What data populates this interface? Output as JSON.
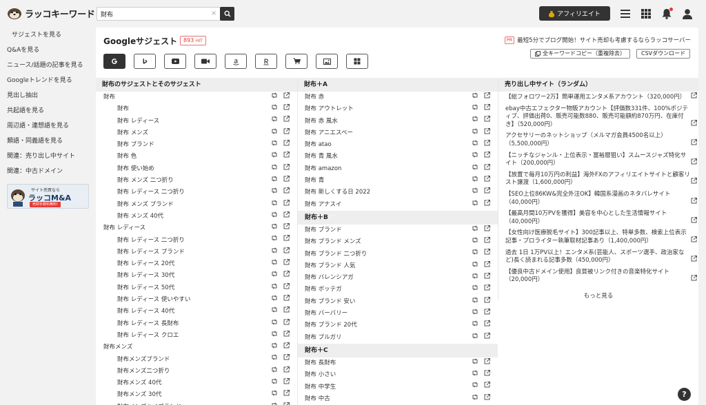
{
  "header": {
    "logo_text": "ラッコキーワード",
    "search": {
      "value": "財布",
      "clear_icon": "×"
    },
    "affiliate_label": "アフィリエイト"
  },
  "sidebar": {
    "items": [
      "サジェストを見る",
      "Q&Aを見る",
      "ニュース/話題の記事を見る",
      "Googleトレンドを見る",
      "見出し抽出",
      "共起語を見る",
      "周辺語・連想語を見る",
      "類語・同義語を見る",
      "関連：売り出し中サイト",
      "関連：中古ドメイン"
    ],
    "banner": {
      "small": "サイト売買なら",
      "big": "ラッコM&A",
      "red": "売却手数料無料!"
    }
  },
  "main": {
    "title": "Googleサジェスト",
    "hit_count": "893",
    "hit_unit": "HIT",
    "pr_tag": "PR",
    "pr_text": "最短5分でブログ開始！サイト売却も考慮するならラッコサーバー",
    "copy_all_label": "全キーワードコピー（重複除去）",
    "csv_label": "CSVダウンロード"
  },
  "col1": {
    "header": "財布のサジェストとそのサジェスト",
    "rows": [
      {
        "text": "財布",
        "level": 1
      },
      {
        "text": "財布",
        "level": 2
      },
      {
        "text": "財布 レディース",
        "level": 2
      },
      {
        "text": "財布 メンズ",
        "level": 2
      },
      {
        "text": "財布 ブランド",
        "level": 2
      },
      {
        "text": "財布 色",
        "level": 2
      },
      {
        "text": "財布 使い始め",
        "level": 2
      },
      {
        "text": "財布 メンズ 二つ折り",
        "level": 2
      },
      {
        "text": "財布 レディース 二つ折り",
        "level": 2
      },
      {
        "text": "財布 メンズ ブランド",
        "level": 2
      },
      {
        "text": "財布 メンズ 40代",
        "level": 2
      },
      {
        "text": "財布 レディース",
        "level": 1
      },
      {
        "text": "財布 レディース 二つ折り",
        "level": 2
      },
      {
        "text": "財布 レディース ブランド",
        "level": 2
      },
      {
        "text": "財布 レディース 20代",
        "level": 2
      },
      {
        "text": "財布 レディース 30代",
        "level": 2
      },
      {
        "text": "財布 レディース 50代",
        "level": 2
      },
      {
        "text": "財布 レディース 使いやすい",
        "level": 2
      },
      {
        "text": "財布 レディース 40代",
        "level": 2
      },
      {
        "text": "財布 レディース 長財布",
        "level": 2
      },
      {
        "text": "財布 レディース クロエ",
        "level": 2
      },
      {
        "text": "財布メンズ",
        "level": 1
      },
      {
        "text": "財布メンズブランド",
        "level": 2
      },
      {
        "text": "財布メンズ二つ折り",
        "level": 2
      },
      {
        "text": "財布メンズ 40代",
        "level": 2
      },
      {
        "text": "財布メンズ 30代",
        "level": 2
      },
      {
        "text": "財布メンズハイブランド",
        "level": 2
      }
    ]
  },
  "col2": {
    "groups": [
      {
        "header": "財布＋A",
        "rows": [
          "財布 赤",
          "財布 アウトレット",
          "財布 赤 風水",
          "財布 アニエスベー",
          "財布 atao",
          "財布 青 風水",
          "財布 amazon",
          "財布 青",
          "財布 新しくする日 2022",
          "財布 アナスイ"
        ]
      },
      {
        "header": "財布＋B",
        "rows": [
          "財布 ブランド",
          "財布 ブランド メンズ",
          "財布 ブランド 二つ折り",
          "財布 ブランド 人気",
          "財布 バレンシアガ",
          "財布 ボッテガ",
          "財布 ブランド 安い",
          "財布 バーバリー",
          "財布 ブランド 20代",
          "財布 ブルガリ"
        ]
      },
      {
        "header": "財布＋C",
        "rows": [
          "財布 長財布",
          "財布 小さい",
          "財布 中学生",
          "財布 中古"
        ]
      }
    ]
  },
  "col3": {
    "header": "売り出し中サイト（ランダム）",
    "items": [
      "【総フォロワー2万】簡単運用エンタメ系アカウント（320,000円）",
      "ebay中古エフェクター物販アカウント【評価数331件、100%ポジティブ、評価出荷0、販売可能数880、販売可能額約870万円、在庫付き】（520,000円）",
      "アクセサリーのネットショップ（メルマガ会員4500名以上）（5,500,000円）",
      "【ニッチなジャンル・上位表示・冨裕層狙い】スムースジャズ特化サイト（200,000円）",
      "【放置で毎月10万円の利益】海外FXのアフィリエイトサイトと顧客リスト譲渡（1,600,000円）",
      "【SEO上位86KW&完全外注OK】韓国系漫画のネタバレサイト（40,000円）",
      "【最高月間10万PVを獲得】美容を中心とした生活情報サイト（40,000円）",
      "【女性向け医療脱毛サイト】300記事以上、特単多数、検索上位表示記事・プロライター執筆取材記事あり（1,400,000円）",
      "過去 1日 1万PV以上！エンタメ系(芸能人、スポーツ選手、政治家など)長く読まれる記事多数（450,000円）",
      "【優良中古ドメイン使用】良質被リンク付きの音楽特化サイト（20,000円）"
    ],
    "more_label": "もっと見る"
  },
  "help_label": "?",
  "colors": {
    "accent": "#333333",
    "badge_red": "#e53935",
    "header_bg": "#eeeeee"
  },
  "icons": [
    "retweet-icon",
    "external-link-icon",
    "search-icon",
    "menu-icon",
    "grid-icon",
    "bell-icon",
    "user-icon",
    "copy-icon",
    "download-icon"
  ]
}
